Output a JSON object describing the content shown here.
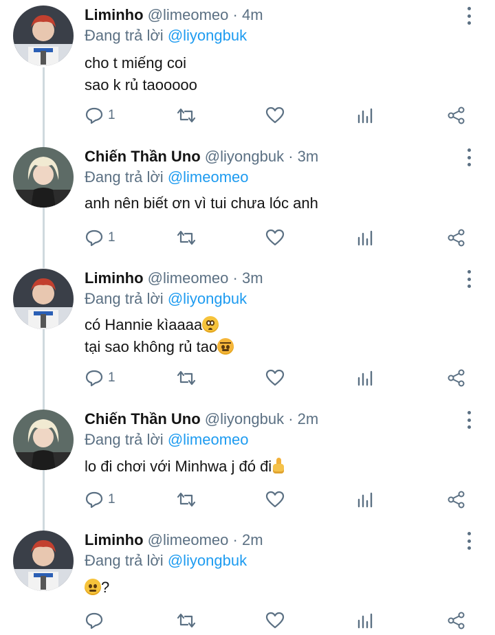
{
  "tweets": [
    {
      "name": "Liminho",
      "handle": "@limeomeo",
      "sep": "·",
      "time": "4m",
      "reply_prefix": "Đang trả lời",
      "reply_to": "@liyongbuk",
      "lines": [
        "cho t miếng coi",
        "sao k rủ taooooo"
      ],
      "reply_count": "1"
    },
    {
      "name": "Chiến Thần Uno",
      "handle": "@liyongbuk",
      "sep": "·",
      "time": "3m",
      "reply_prefix": "Đang trả lời",
      "reply_to": "@limeomeo",
      "lines": [
        "anh nên biết ơn vì tui chưa lóc anh"
      ],
      "reply_count": "1"
    },
    {
      "name": "Liminho",
      "handle": "@limeomeo",
      "sep": "·",
      "time": "3m",
      "reply_prefix": "Đang trả lời",
      "reply_to": "@liyongbuk",
      "lines": [
        "có Hannie kìaaaa",
        "tại sao không rủ tao"
      ],
      "emojis": [
        "pleading-face",
        "angry-face"
      ],
      "reply_count": "1"
    },
    {
      "name": "Chiến Thần Uno",
      "handle": "@liyongbuk",
      "sep": "·",
      "time": "2m",
      "reply_prefix": "Đang trả lời",
      "reply_to": "@limeomeo",
      "lines": [
        "lo đi chơi với Minhwa j đó đi"
      ],
      "emojis": [
        "thumbs-up"
      ],
      "reply_count": "1"
    },
    {
      "name": "Liminho",
      "handle": "@limeomeo",
      "sep": "·",
      "time": "2m",
      "reply_prefix": "Đang trả lời",
      "reply_to": "@liyongbuk",
      "lines": [
        "?"
      ],
      "emojis": [
        "face-with-raised-eyebrow"
      ],
      "reply_count": ""
    }
  ],
  "icons": {
    "reply": "reply-icon",
    "retweet": "retweet-icon",
    "like": "heart-icon",
    "analytics": "analytics-icon",
    "share": "share-icon",
    "menu": "more-vertical-icon"
  },
  "colors": {
    "accent": "#1d9bf0",
    "muted": "#5b7083",
    "text": "#141414",
    "thread_line": "#cfd9de"
  }
}
